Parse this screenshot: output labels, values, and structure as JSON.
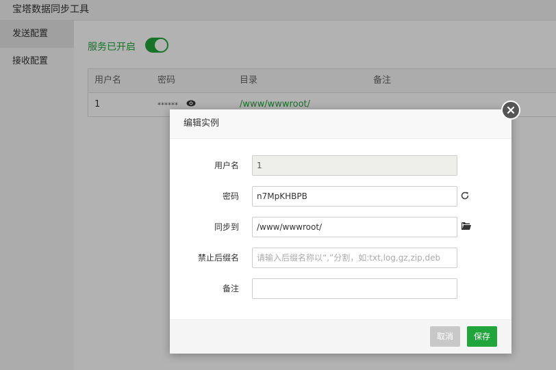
{
  "app": {
    "title": "宝塔数据同步工具"
  },
  "sidebar": {
    "items": [
      {
        "label": "发送配置"
      },
      {
        "label": "接收配置"
      }
    ]
  },
  "service": {
    "status_label": "服务已开启",
    "enabled": true
  },
  "table": {
    "headers": [
      "用户名",
      "密码",
      "目录",
      "备注"
    ],
    "rows": [
      {
        "username": "1",
        "password_mask": "******",
        "directory": "/www/wwwroot/",
        "note": ""
      }
    ]
  },
  "dialog": {
    "title": "编辑实例",
    "fields": {
      "username": {
        "label": "用户名",
        "value": "1"
      },
      "password": {
        "label": "密码",
        "value": "n7MpKHBPB"
      },
      "sync_to": {
        "label": "同步到",
        "value": "/www/wwwroot/"
      },
      "exclude": {
        "label": "禁止后缀名",
        "placeholder": "请输入后缀名称以“,”分割，如:txt,log,gz,zip,deb",
        "value": ""
      },
      "note": {
        "label": "备注",
        "value": ""
      }
    },
    "buttons": {
      "cancel": "取消",
      "save": "保存"
    }
  },
  "colors": {
    "accent": "#20a53a",
    "cancel": "#c8c8c8"
  },
  "icons": [
    "eye-icon",
    "refresh-icon",
    "folder-open-icon",
    "close-icon"
  ]
}
